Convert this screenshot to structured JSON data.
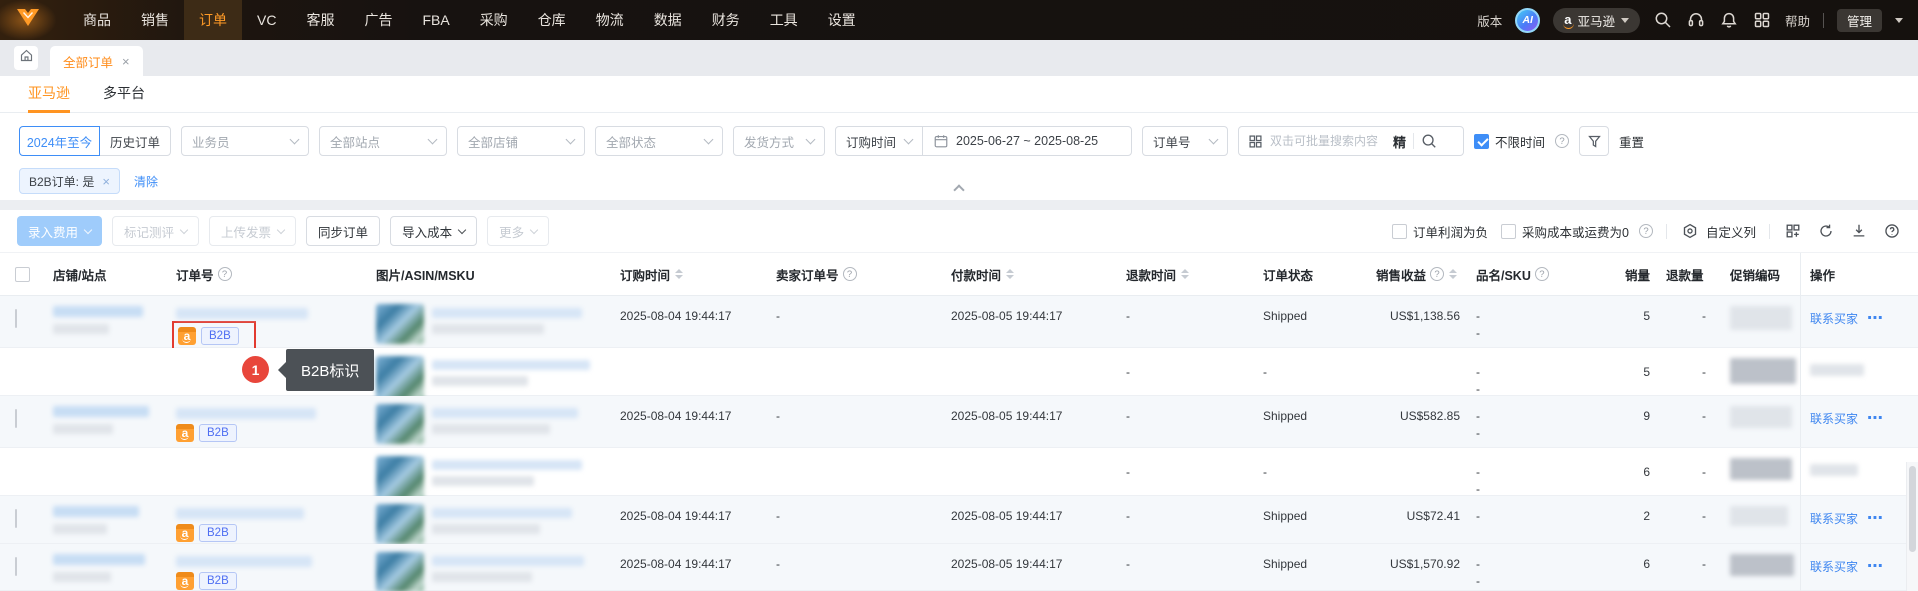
{
  "nav": {
    "items": [
      "商品",
      "销售",
      "订单",
      "VC",
      "客服",
      "广告",
      "FBA",
      "采购",
      "仓库",
      "物流",
      "数据",
      "财务",
      "工具",
      "设置"
    ],
    "active_item": "订单",
    "version_label": "版本",
    "ai_badge": "AI",
    "platform": "亚马逊",
    "help_label": "帮助",
    "admin_label": "管理"
  },
  "tabbar": {
    "active_tab": "全部订单",
    "close_icon": "×"
  },
  "subtabs": {
    "amazon": "亚马逊",
    "multi_platform": "多平台"
  },
  "filters": {
    "range_current": "2024年至今",
    "range_history": "历史订单",
    "salesman": "业务员",
    "site": "全部站点",
    "store": "全部店铺",
    "status": "全部状态",
    "shipping": "发货方式",
    "order_time": "订购时间",
    "date_range": "2025-06-27 ~ 2025-08-25",
    "order_no": "订单号",
    "search_placeholder": "双击可批量搜索内容",
    "exact": "精",
    "unlimited_time": "不限时间",
    "reset": "重置",
    "applied_tag": "B2B订单: 是",
    "tag_close": "×",
    "clear": "清除"
  },
  "toolbar": {
    "enter_fee": "录入费用",
    "mark_review": "标记测评",
    "upload_invoice": "上传发票",
    "sync_order": "同步订单",
    "import_cost": "导入成本",
    "more": "更多",
    "profit_negative": "订单利润为负",
    "cost_or_freight_zero": "采购成本或运费为0",
    "custom_columns": "自定义列"
  },
  "table": {
    "headers": {
      "store": "店铺/站点",
      "order_no": "订单号",
      "image": "图片/ASIN/MSKU",
      "order_time": "订购时间",
      "seller_order_no": "卖家订单号",
      "pay_time": "付款时间",
      "refund_time": "退款时间",
      "status": "订单状态",
      "revenue": "销售收益",
      "sku": "品名/SKU",
      "qty": "销量",
      "refund_qty": "退款量",
      "promo_code": "促销编码",
      "action": "操作"
    },
    "b2b_badge": "B2B",
    "contact_buyer": "联系买家",
    "more_dots": "⋯",
    "rows": [
      {
        "order_time": "2025-08-04 19:44:17",
        "seller_order_no": "-",
        "pay_time": "2025-08-05 19:44:17",
        "refund_time": "-",
        "status": "Shipped",
        "revenue": "US$1,138.56",
        "sku1": "-",
        "sku2": "-",
        "qty": "5",
        "refund_qty": "-"
      },
      {
        "refund_time": "-",
        "status": "-",
        "sku1": "-",
        "sku2": "-",
        "qty": "5",
        "refund_qty": "-"
      },
      {
        "order_time": "2025-08-04 19:44:17",
        "seller_order_no": "-",
        "pay_time": "2025-08-05 19:44:17",
        "refund_time": "-",
        "status": "Shipped",
        "revenue": "US$582.85",
        "sku1": "-",
        "sku2": "-",
        "qty": "9",
        "refund_qty": "-"
      },
      {
        "refund_time": "-",
        "status": "-",
        "sku1": "-",
        "sku2": "-",
        "qty": "6",
        "refund_qty": "-"
      },
      {
        "order_time": "2025-08-04 19:44:17",
        "seller_order_no": "-",
        "pay_time": "2025-08-05 19:44:17",
        "refund_time": "-",
        "status": "Shipped",
        "revenue": "US$72.41",
        "sku1": "-",
        "qty": "2",
        "refund_qty": "-"
      },
      {
        "order_time": "2025-08-04 19:44:17",
        "seller_order_no": "-",
        "pay_time": "2025-08-05 19:44:17",
        "refund_time": "-",
        "status": "Shipped",
        "revenue": "US$1,570.92",
        "sku1": "-",
        "sku2": "-",
        "qty": "6",
        "refund_qty": "-"
      }
    ]
  },
  "annotation": {
    "number": "1",
    "label": "B2B标识"
  },
  "colors": {
    "accent_orange": "#ff9421",
    "accent_blue": "#3e8ef7",
    "highlight_red": "#e23b30",
    "badge_blue": "#4e6ef2",
    "annotation_red": "#e8463b",
    "tooltip_gray": "#4c5156",
    "shaded_row": "#f5f8fb"
  }
}
